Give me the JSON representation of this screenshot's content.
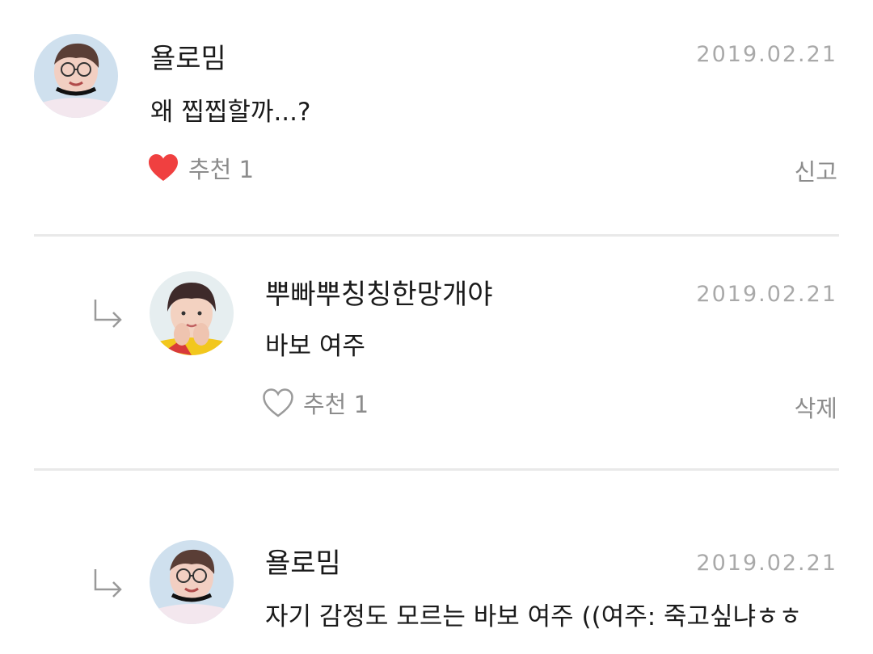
{
  "comments": [
    {
      "username": "욜로밈",
      "date": "2019.02.21",
      "text": "왜 찝찝할까...?",
      "like_label": "추천 1",
      "liked": true,
      "action_label": "신고",
      "is_reply": false
    },
    {
      "username": "뿌빠뿌칭칭한망개야",
      "date": "2019.02.21",
      "text": "바보 여주",
      "like_label": "추천 1",
      "liked": false,
      "action_label": "삭제",
      "is_reply": true
    },
    {
      "username": "욜로밈",
      "date": "2019.02.21",
      "text": "자기 감정도 모르는 바보 여주 ((여주: 죽고싶냐ㅎㅎ",
      "is_reply": true
    }
  ],
  "colors": {
    "heart_filled": "#f04040",
    "heart_outline": "#9a9a9a",
    "muted_text": "#8c8c8c",
    "date_text": "#a9a9a9",
    "divider": "#e9e9e9"
  },
  "icons": {
    "liked": "heart-filled-icon",
    "unliked": "heart-outline-icon",
    "reply": "reply-arrow-icon"
  }
}
